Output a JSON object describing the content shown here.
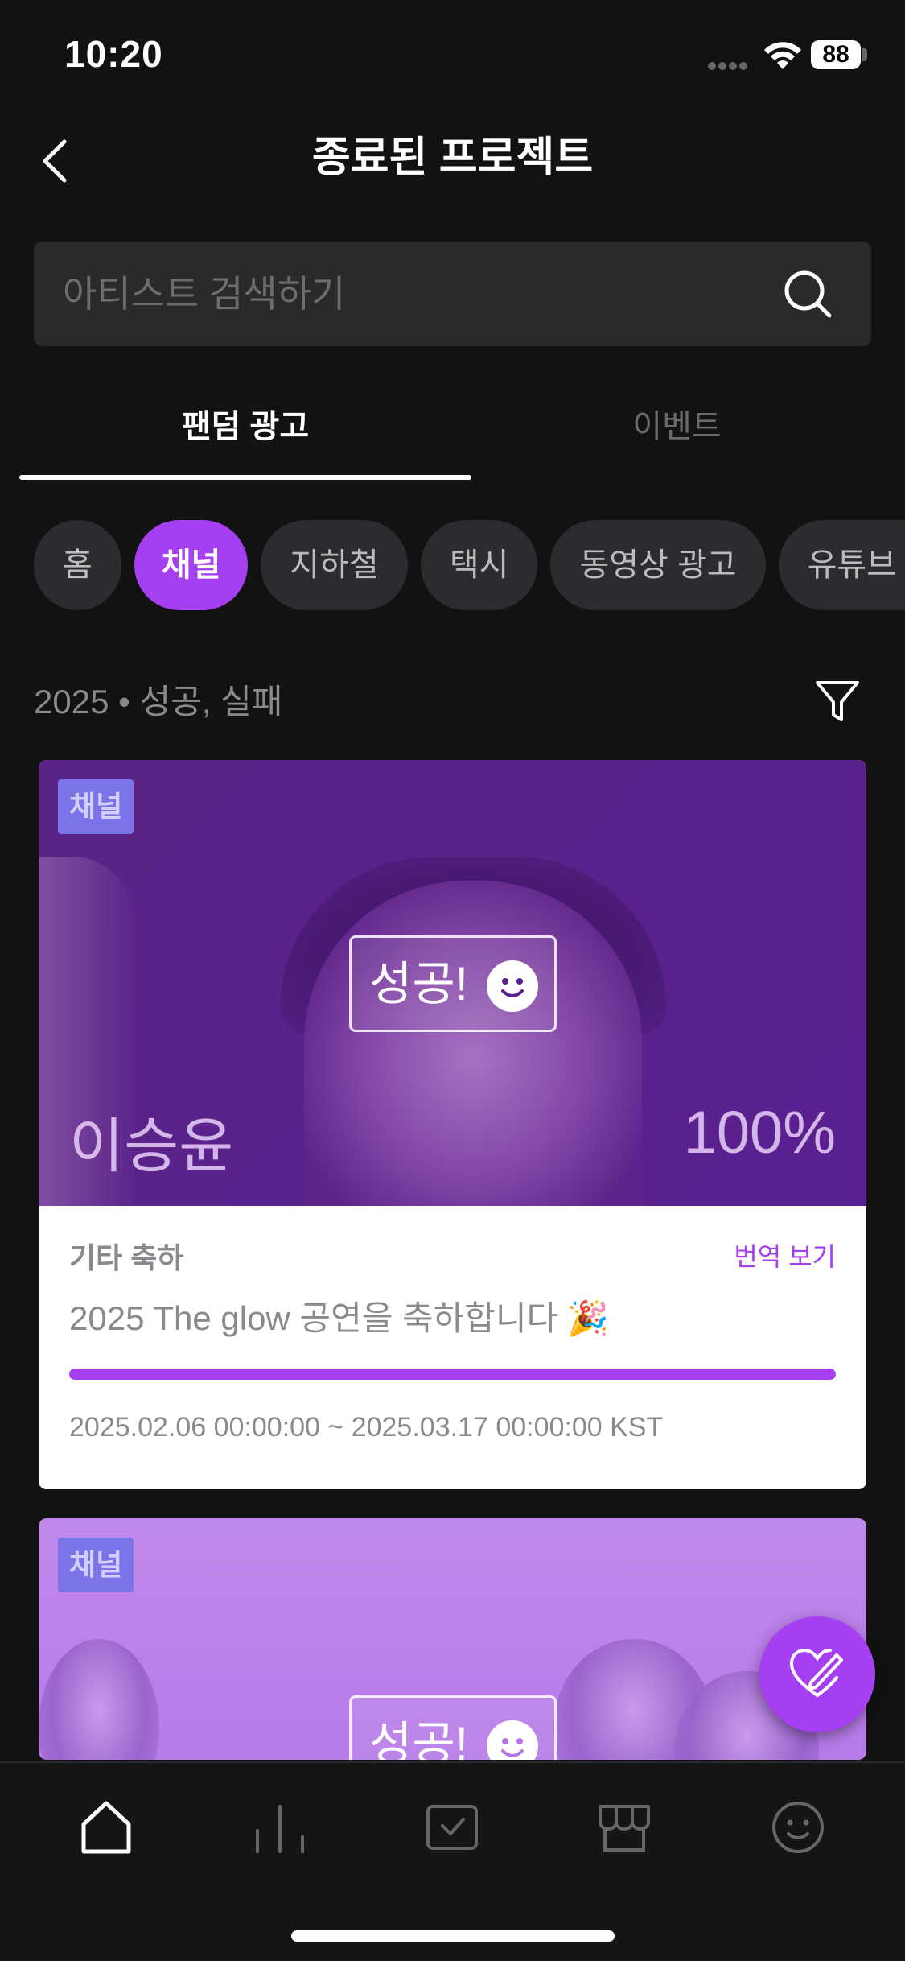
{
  "status_bar": {
    "time": "10:20",
    "battery": "88"
  },
  "header": {
    "title": "종료된 프로젝트"
  },
  "search": {
    "placeholder": "아티스트 검색하기"
  },
  "tabs": [
    {
      "label": "팬덤 광고",
      "active": true
    },
    {
      "label": "이벤트",
      "active": false
    }
  ],
  "chips": [
    {
      "label": "홈",
      "active": false
    },
    {
      "label": "채널",
      "active": true
    },
    {
      "label": "지하철",
      "active": false
    },
    {
      "label": "택시",
      "active": false
    },
    {
      "label": "동영상 광고",
      "active": false
    },
    {
      "label": "유튜브 M",
      "active": false
    }
  ],
  "filter": {
    "label": "2025 • 성공, 실패"
  },
  "cards": [
    {
      "tag": "채널",
      "status": "성공!",
      "artist": "이승윤",
      "percent": "100%",
      "progress": 1.0,
      "category": "기타 축하",
      "translate_label": "번역 보기",
      "message": "2025 The glow  공연을  축하합니다 🎉",
      "dates": "2025.02.06 00:00:00 ~ 2025.03.17 00:00:00 KST"
    },
    {
      "tag": "채널",
      "status": "성공!"
    }
  ],
  "colors": {
    "accent": "#a63ef2",
    "background": "#121212",
    "tag": "#7a74e8"
  },
  "bottom_nav": [
    {
      "icon": "home-icon",
      "active": true
    },
    {
      "icon": "chart-icon",
      "active": false
    },
    {
      "icon": "check-box-icon",
      "active": false
    },
    {
      "icon": "store-icon",
      "active": false
    },
    {
      "icon": "smile-icon",
      "active": false
    }
  ],
  "fab": {
    "icon": "heart-pen-icon"
  }
}
